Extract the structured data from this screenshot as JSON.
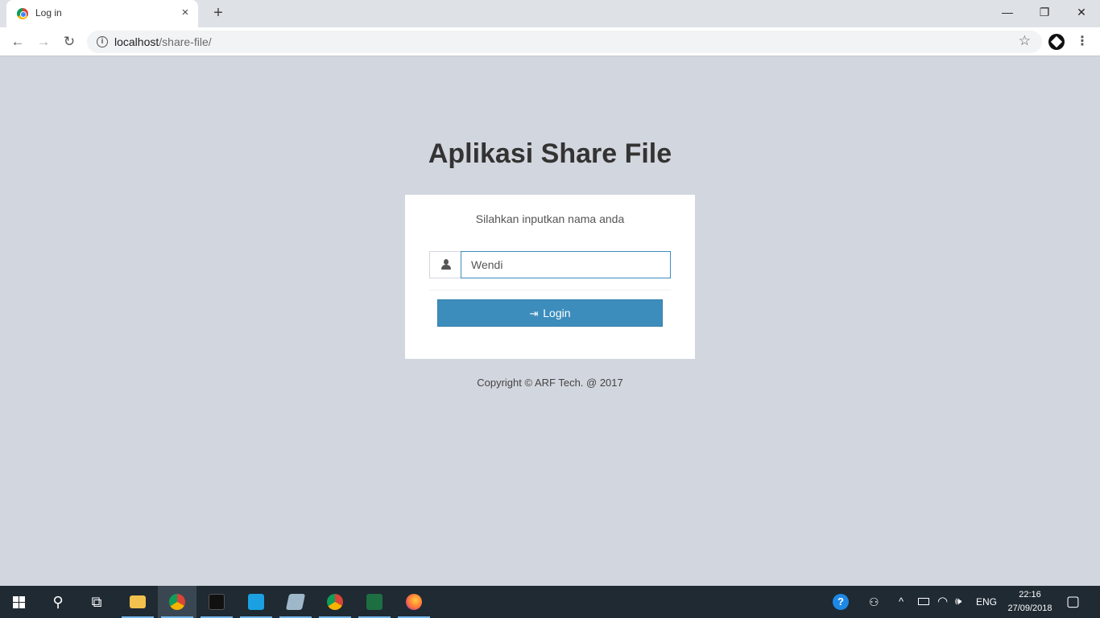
{
  "browser": {
    "tab_title": "Log in",
    "tab_close_glyph": "×",
    "new_tab_glyph": "+",
    "url_host": "localhost",
    "url_path": "/share-file/",
    "minimize_glyph": "—",
    "maximize_glyph": "❐",
    "close_glyph": "✕",
    "back_glyph": "←",
    "forward_glyph": "→",
    "reload_glyph": "↻",
    "bookmark_glyph": "☆",
    "menu_glyph": "⋮",
    "info_glyph": "i"
  },
  "page": {
    "title": "Aplikasi Share File",
    "login_message": "Silahkan inputkan nama anda",
    "name_value": "Wendi",
    "login_button_label": "Login",
    "login_icon_glyph": "⇥",
    "copyright": "Copyright © ARF Tech. @ 2017"
  },
  "colors": {
    "background": "#d2d6de",
    "primary": "#3c8dbc"
  },
  "taskbar": {
    "search_glyph": "⚲",
    "taskview_glyph": "⧉",
    "language": "ENG",
    "time": "22:16",
    "date": "27/09/2018",
    "notification_glyph": "▢",
    "up_arrow_glyph": "^",
    "network_glyph": "◠",
    "volume_glyph": "🕪",
    "people_glyph": "⚇",
    "help_glyph": "?"
  }
}
